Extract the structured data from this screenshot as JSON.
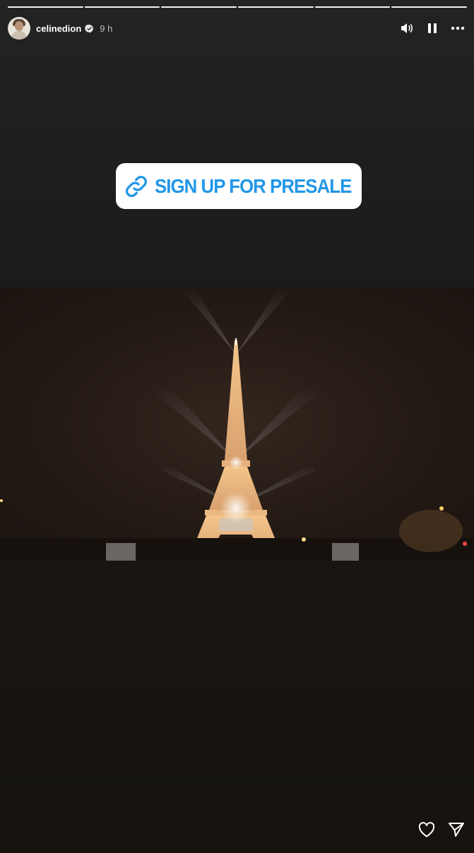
{
  "story": {
    "segments": 6,
    "username": "celinedion",
    "time": "9 h",
    "verified": true
  },
  "controls": {
    "mute_icon": "volume-icon",
    "pause_icon": "pause-icon",
    "more_icon": "more-icon"
  },
  "sticker": {
    "label": "SIGN UP FOR PRESALE",
    "icon": "link-icon",
    "color": "#2097e8"
  },
  "footer": {
    "like_icon": "heart-icon",
    "share_icon": "send-icon"
  }
}
